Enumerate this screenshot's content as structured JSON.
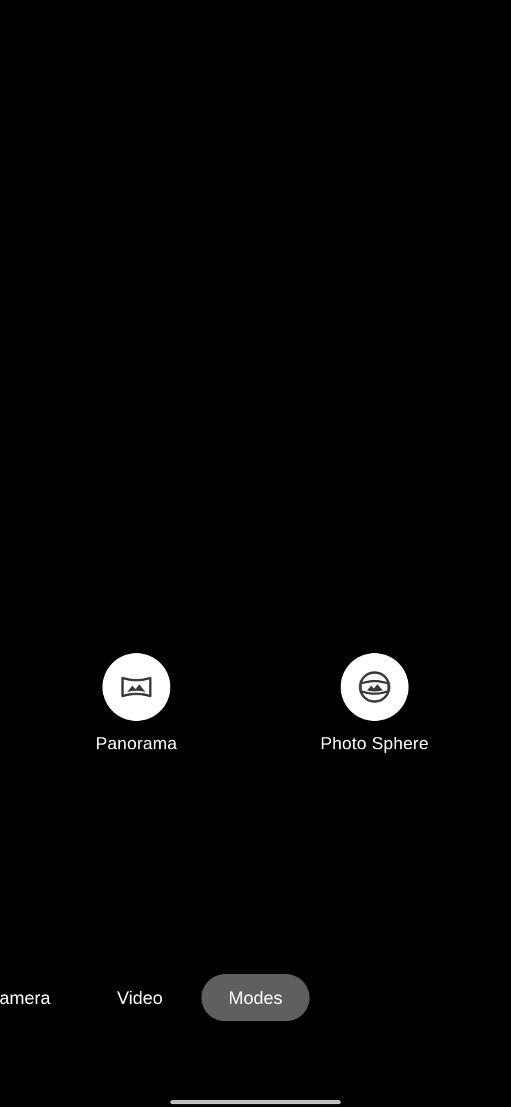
{
  "modes_grid": {
    "items": [
      {
        "label": "Panorama",
        "icon": "panorama-icon"
      },
      {
        "label": "Photo Sphere",
        "icon": "photo-sphere-icon"
      }
    ]
  },
  "mode_tabs": {
    "camera": "amera",
    "video": "Video",
    "modes": "Modes",
    "selected": "Modes"
  },
  "colors": {
    "background": "#000000",
    "selected_tab": "#5f5f5f",
    "icon_circle": "#ffffff",
    "icon_glyph": "#3c3c3c"
  }
}
